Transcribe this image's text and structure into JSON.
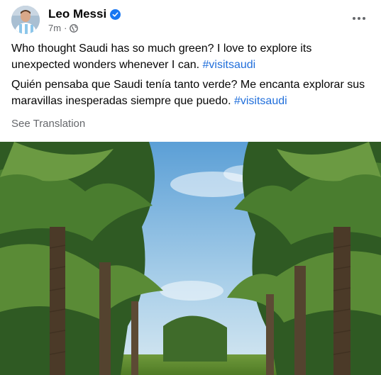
{
  "post": {
    "author": "Leo Messi",
    "time": "7m",
    "separator": "·",
    "paragraph_en": "Who thought Saudi has so much green? I love to explore its unexpected wonders whenever I can.",
    "paragraph_es": "Quién pensaba que Saudi tenía tanto verde? Me encanta explorar sus maravillas inesperadas siempre que puedo.",
    "hashtag": "#visitsaudi",
    "see_translation": "See Translation"
  },
  "icons": {
    "verified": "verified-badge-icon",
    "audience": "globe-icon",
    "more": "more-options-icon"
  },
  "colors": {
    "verified": "#1877f2",
    "hashtag": "#216fdb",
    "secondary_text": "#65676b"
  }
}
